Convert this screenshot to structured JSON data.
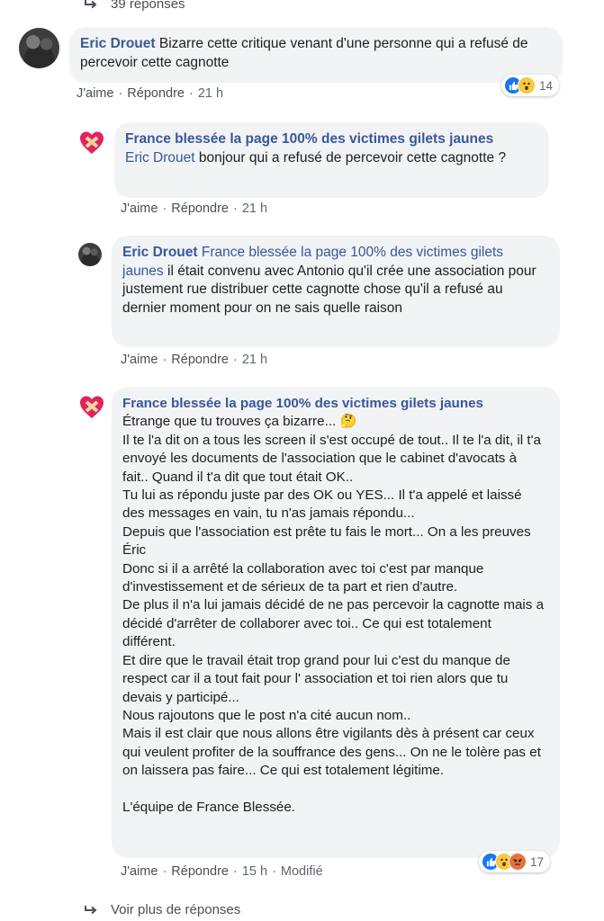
{
  "top_replies_link": "39 réponses",
  "comments": [
    {
      "author": "Eric Drouet",
      "text": "Bizarre cette critique venant d'une personne qui a refusé de percevoir cette cagnotte",
      "like": "J'aime",
      "reply": "Répondre",
      "time": "21 h",
      "reactions": [
        "like",
        "wow"
      ],
      "reaction_count": "14"
    },
    {
      "author": "France blessée la page 100% des victimes gilets jaunes",
      "tag": "Eric Drouet",
      "text": "bonjour qui a refusé de percevoir cette cagnotte ?",
      "like": "J'aime",
      "reply": "Répondre",
      "time": "21 h"
    },
    {
      "author": "Eric Drouet",
      "tag": "France blessée la page 100% des victimes gilets jaunes",
      "text": "il était convenu avec Antonio qu'il crée une association pour justement rue distribuer cette cagnotte chose qu'il a refusé au dernier moment pour on ne sais quelle raison",
      "like": "J'aime",
      "reply": "Répondre",
      "time": "21 h"
    },
    {
      "author": "France blessée la page 100% des victimes gilets jaunes",
      "paragraphs": [
        "Étrange que tu trouves ça bizarre... 🤔",
        "Il te l'a dit on a tous les screen il s'est occupé de tout.. Il te l'a dit, il t'a envoyé les documents de l'association que le cabinet d'avocats à fait.. Quand il t'a dit que tout était OK..",
        "Tu lui as répondu juste par des OK ou YES... Il t'a appelé et laissé des messages en vain, tu n'as jamais répondu...",
        "Depuis que l'association est prête tu fais le mort... On a les preuves Éric",
        "Donc si il a arrêté la collaboration avec toi c'est par manque d'investissement et de sérieux de ta part et rien d'autre.",
        "De plus il n'a lui jamais décidé de ne pas percevoir la cagnotte mais a décidé d'arrêter de collaborer avec toi.. Ce qui est totalement différent.",
        "Et dire que le travail était trop grand pour lui c'est du manque de respect car il a tout fait pour l' association et toi rien alors que tu devais y participé...",
        "Nous rajoutons que le post n'a cité aucun nom..",
        "Mais il est clair que nous allons être vigilants dès à présent car ceux qui veulent profiter de la souffrance des gens... On ne le tolère pas et on laissera pas faire... Ce qui est totalement légitime."
      ],
      "signature": "L'équipe de France Blessée.",
      "like": "J'aime",
      "reply": "Répondre",
      "time": "15 h",
      "edited": "Modifié",
      "reactions": [
        "like",
        "wow",
        "angry"
      ],
      "reaction_count": "17"
    }
  ],
  "more_replies_link": "Voir plus de réponses",
  "colors": {
    "link_blue": "#385898",
    "bubble_bg": "#f2f3f5",
    "meta_gray": "#606770",
    "like_blue": "#1877f2",
    "heart_red": "#e0245e"
  },
  "icons": {
    "reply_arrow": "reply-arrow-icon",
    "heart": "heart-bandage-icon",
    "like": "like-reaction-icon",
    "wow": "wow-reaction-icon",
    "angry": "angry-reaction-icon"
  }
}
